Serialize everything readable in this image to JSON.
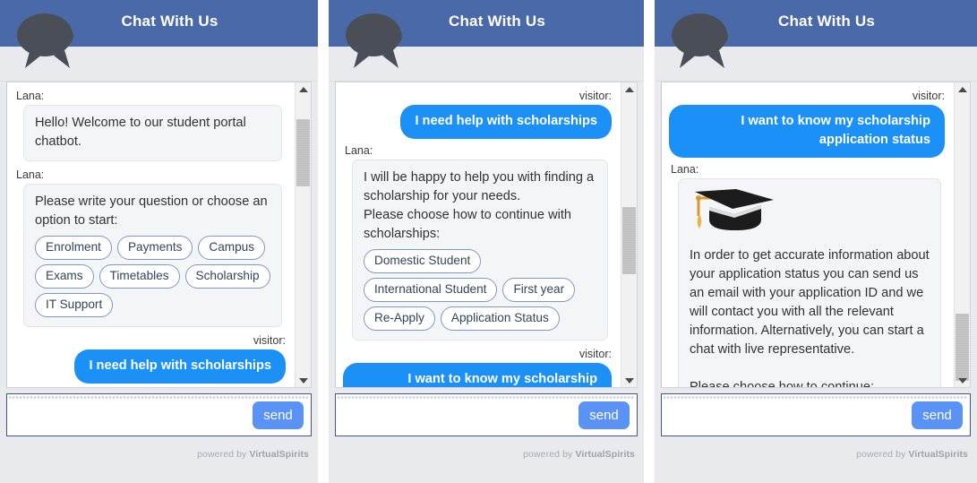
{
  "widget": {
    "title": "Chat With Us",
    "bot_name": "Lana:",
    "visitor_name": "visitor:",
    "send_label": "send",
    "input_placeholder": "",
    "input_value": "",
    "powered_prefix": "powered by",
    "powered_brand": "VirtualSpirits",
    "icons": {
      "header": "speech-bubbles-icon",
      "graduation": "graduation-cap-icon",
      "scroll_up": "scroll-up-arrow-icon",
      "scroll_down": "scroll-down-arrow-icon"
    },
    "colors": {
      "header_blue": "#4a69a8",
      "user_bubble_blue": "#1b90f7",
      "send_blue": "#5a92f5",
      "bot_bubble_gray": "#f4f5f6",
      "option_border": "#7b98c8",
      "panel_bg": "#e9eaee"
    }
  },
  "panels": [
    {
      "id": "panel-1",
      "scroll_thumb_top_pct": 5,
      "scroll_thumb_height_pct": 22,
      "messages": [
        {
          "role": "bot",
          "speaker": "Lana:",
          "text": "Hello! Welcome to our student portal chatbot.",
          "options": []
        },
        {
          "role": "bot",
          "speaker": "Lana:",
          "text": "Please write your question or choose an option to start:",
          "options": [
            "Enrolment",
            "Payments",
            "Campus",
            "Exams",
            "Timetables",
            "Scholarship",
            "IT Support"
          ]
        },
        {
          "role": "user",
          "speaker": "visitor:",
          "text": "I need help with scholarships",
          "options": []
        }
      ]
    },
    {
      "id": "panel-2",
      "scroll_thumb_top_pct": 41,
      "scroll_thumb_height_pct": 22,
      "messages": [
        {
          "role": "user",
          "speaker": "visitor:",
          "text": "I need help with scholarships",
          "options": []
        },
        {
          "role": "bot",
          "speaker": "Lana:",
          "text": "I will be happy to help you with finding a scholarship for your needs.\nPlease choose how to continue with scholarships:",
          "options": [
            "Domestic Student",
            "International Student",
            "First year",
            "Re-Apply",
            "Application Status"
          ]
        },
        {
          "role": "user",
          "speaker": "visitor:",
          "text": "I want to know my scholarship application status",
          "options": []
        }
      ]
    },
    {
      "id": "panel-3",
      "scroll_thumb_top_pct": 76,
      "scroll_thumb_height_pct": 22,
      "messages": [
        {
          "role": "user",
          "speaker": "visitor:",
          "text": "I want to know my scholarship application status",
          "options": []
        },
        {
          "role": "bot",
          "speaker": "Lana:",
          "icon": "graduation-cap-icon",
          "text": "In order to get accurate information about your application status you can send us an email with your application ID and we will contact you with all the relevant information. Alternatively, you can start a chat with live representative.",
          "text2": "Please choose how to continue:",
          "options": []
        }
      ]
    }
  ]
}
